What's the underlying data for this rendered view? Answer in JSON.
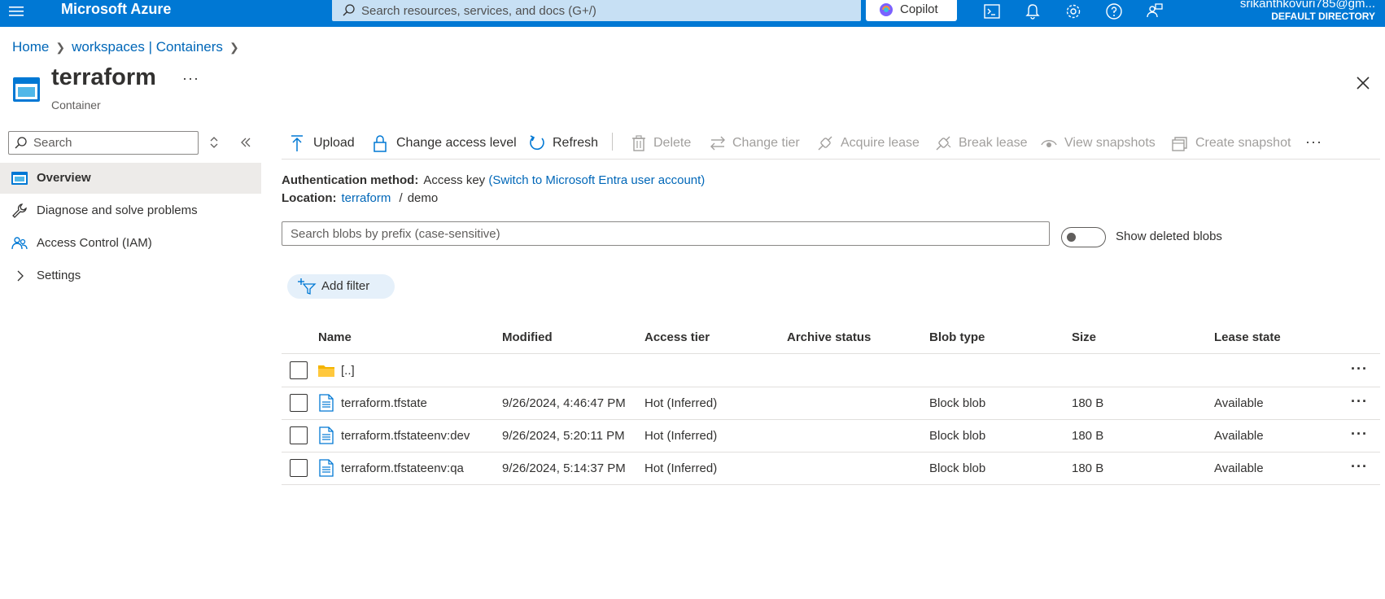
{
  "topbar": {
    "brand": "Microsoft Azure",
    "search_placeholder": "Search resources, services, and docs (G+/)",
    "copilot_label": "Copilot",
    "user_email": "srikanthkovuri785@gm...",
    "user_directory": "DEFAULT DIRECTORY",
    "color": "#0078d4"
  },
  "breadcrumb": {
    "home": "Home",
    "workspaces": "workspaces | Containers"
  },
  "header": {
    "title": "terraform",
    "subtitle": "Container",
    "more": "···"
  },
  "nav": {
    "search_placeholder": "Search",
    "items": [
      {
        "label": "Overview",
        "icon": "container-icon"
      },
      {
        "label": "Diagnose and solve problems",
        "icon": "wrench-icon"
      },
      {
        "label": "Access Control (IAM)",
        "icon": "people-icon"
      },
      {
        "label": "Settings",
        "icon": "chevron-right-icon"
      }
    ]
  },
  "commands": {
    "upload": "Upload",
    "change_access": "Change access level",
    "refresh": "Refresh",
    "delete": "Delete",
    "change_tier": "Change tier",
    "acquire_lease": "Acquire lease",
    "break_lease": "Break lease",
    "view_snapshots": "View snapshots",
    "create_snapshot": "Create snapshot",
    "more": "···"
  },
  "info": {
    "auth_label": "Authentication method:",
    "auth_value": "Access key",
    "auth_link": "(Switch to Microsoft Entra user account)",
    "location_label": "Location:",
    "location_link": "terraform",
    "location_sep": "/",
    "location_rest": "demo"
  },
  "blob_search": {
    "placeholder": "Search blobs by prefix (case-sensitive)",
    "show_deleted_label": "Show deleted blobs"
  },
  "filter": {
    "add_filter_label": "Add filter"
  },
  "table": {
    "columns": [
      "Name",
      "Modified",
      "Access tier",
      "Archive status",
      "Blob type",
      "Size",
      "Lease state"
    ],
    "rows": [
      {
        "name": "[..]",
        "modified": "",
        "tier": "",
        "archive": "",
        "type": "",
        "size": "",
        "lease": "",
        "icon": "folder-icon"
      },
      {
        "name": "terraform.tfstate",
        "modified": "9/26/2024, 4:46:47 PM",
        "tier": "Hot (Inferred)",
        "archive": "",
        "type": "Block blob",
        "size": "180 B",
        "lease": "Available",
        "icon": "file-icon"
      },
      {
        "name": "terraform.tfstateenv:dev",
        "modified": "9/26/2024, 5:20:11 PM",
        "tier": "Hot (Inferred)",
        "archive": "",
        "type": "Block blob",
        "size": "180 B",
        "lease": "Available",
        "icon": "file-icon"
      },
      {
        "name": "terraform.tfstateenv:qa",
        "modified": "9/26/2024, 5:14:37 PM",
        "tier": "Hot (Inferred)",
        "archive": "",
        "type": "Block blob",
        "size": "180 B",
        "lease": "Available",
        "icon": "file-icon"
      }
    ],
    "row_more": "···"
  }
}
